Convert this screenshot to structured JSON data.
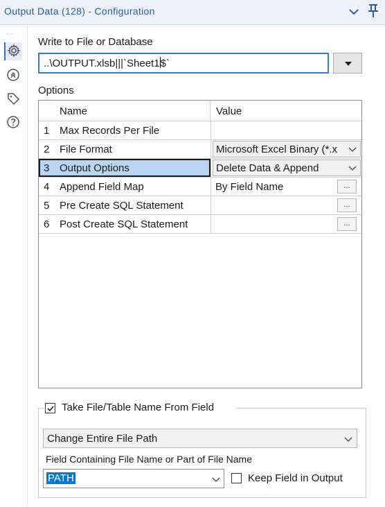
{
  "window": {
    "title": "Output Data (128) - Configuration",
    "collapse_icon": "chevron-down-icon",
    "pin_icon": "pin-icon"
  },
  "sidebar": {
    "more_dots": "...",
    "items": [
      {
        "icon": "gear-icon",
        "active": true
      },
      {
        "icon": "arrows-circle-icon",
        "active": false
      },
      {
        "icon": "tag-icon",
        "active": false
      },
      {
        "icon": "help-icon",
        "active": false
      }
    ]
  },
  "write_target": {
    "label": "Write to File or Database",
    "value_before_caret": "..\\OUTPUT.xlsb|||`Sheet1",
    "value_after_caret": "$`"
  },
  "options": {
    "label": "Options",
    "headers": {
      "name": "Name",
      "value": "Value"
    },
    "rows": [
      {
        "num": "1",
        "name": "Max Records Per File",
        "value": "",
        "control": "text"
      },
      {
        "num": "2",
        "name": "File Format",
        "value": "Microsoft Excel Binary (*.x",
        "control": "combo"
      },
      {
        "num": "3",
        "name": "Output Options",
        "value": "Delete Data & Append",
        "control": "combo",
        "selected": true
      },
      {
        "num": "4",
        "name": "Append Field Map",
        "value": "By Field Name",
        "control": "ellipsis"
      },
      {
        "num": "5",
        "name": "Pre Create SQL Statement",
        "value": "",
        "control": "ellipsis"
      },
      {
        "num": "6",
        "name": "Post Create SQL Statement",
        "value": "",
        "control": "ellipsis"
      }
    ],
    "ellipsis_label": "..."
  },
  "take_from_field": {
    "checkbox_label": "Take File/Table Name From Field",
    "checked": true,
    "mode_value": "Change Entire File Path",
    "field_label": "Field Containing File Name or Part of File Name",
    "field_value": "PATH",
    "keep_label": "Keep Field in Output",
    "keep_checked": false
  },
  "colors": {
    "accent": "#2f7bd8",
    "title_text": "#2b5aa6",
    "selection": "#b9d5f2",
    "highlight": "#0078d7"
  }
}
